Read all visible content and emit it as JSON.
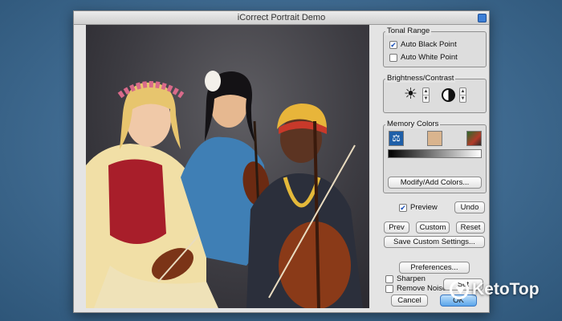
{
  "window": {
    "title": "iCorrect Portrait Demo"
  },
  "tonal_range": {
    "title": "Tonal Range",
    "auto_black_label": "Auto Black Point",
    "auto_black_checked": true,
    "auto_white_label": "Auto White Point",
    "auto_white_checked": false
  },
  "brightness_contrast": {
    "title": "Brightness/Contrast"
  },
  "memory_colors": {
    "title": "Memory Colors",
    "swatches": [
      "#1f5fa8",
      "#d9b48e",
      "#7a3a2a"
    ],
    "modify_button": "Modify/Add Colors..."
  },
  "preview": {
    "label": "Preview",
    "checked": true
  },
  "buttons": {
    "undo": "Undo",
    "prev": "Prev",
    "custom": "Custom",
    "reset": "Reset",
    "save_custom": "Save Custom Settings...",
    "preferences": "Preferences...",
    "cancel": "Cancel",
    "ok": "OK",
    "set": "Set"
  },
  "options": {
    "sharpen_label": "Sharpen",
    "sharpen_checked": false,
    "remove_noise_label": "Remove Noise",
    "remove_noise_checked": false
  },
  "watermark": {
    "text": "KetoTop"
  }
}
